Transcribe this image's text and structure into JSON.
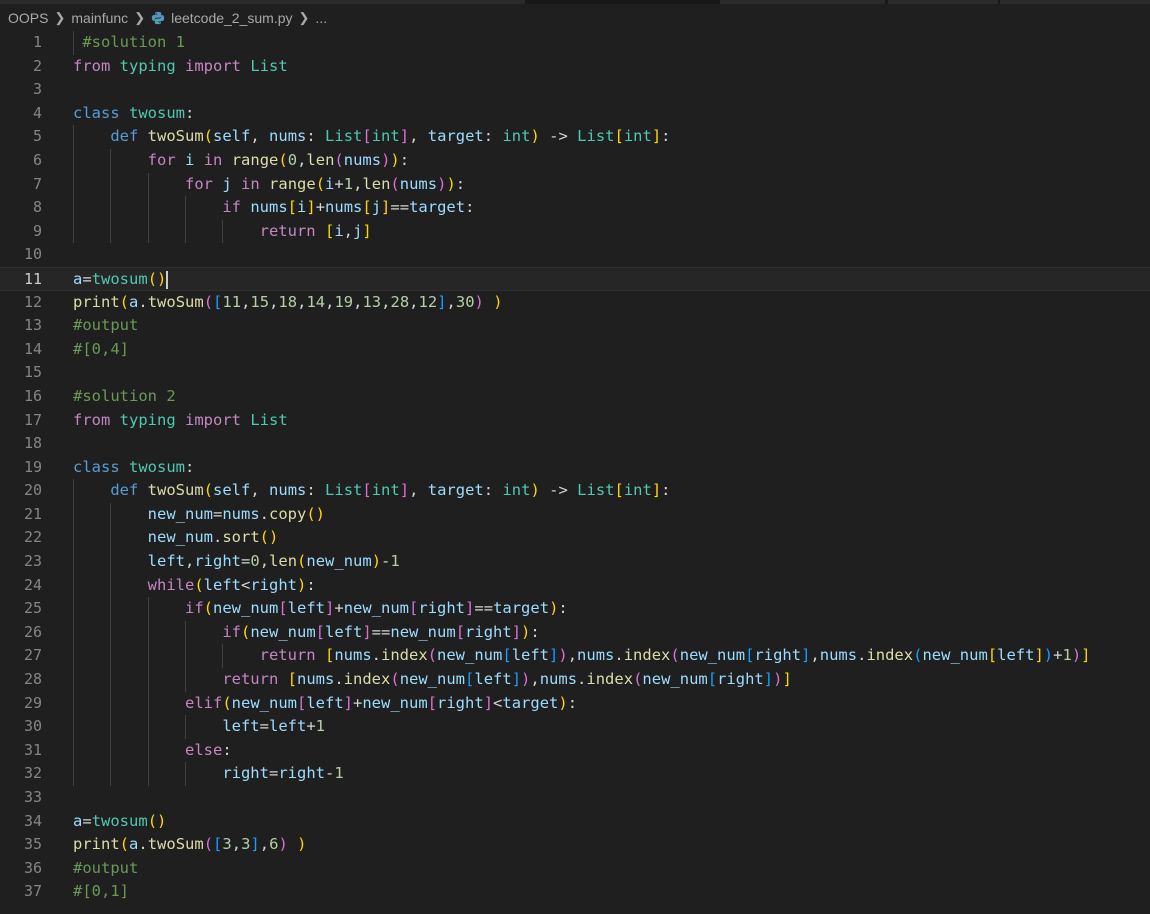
{
  "breadcrumb": {
    "items": [
      "OOPS",
      "mainfunc",
      "leetcode_2_sum.py",
      "..."
    ]
  },
  "editor": {
    "active_line": 11,
    "lines": [
      {
        "n": "1",
        "code": " #solution 1"
      },
      {
        "n": "2",
        "code": "from typing import List"
      },
      {
        "n": "3",
        "code": ""
      },
      {
        "n": "4",
        "code": "class twosum:"
      },
      {
        "n": "5",
        "code": "    def twoSum(self, nums: List[int], target: int) -> List[int]:"
      },
      {
        "n": "6",
        "code": "        for i in range(0,len(nums)):"
      },
      {
        "n": "7",
        "code": "            for j in range(i+1,len(nums)):"
      },
      {
        "n": "8",
        "code": "                if nums[i]+nums[j]==target:"
      },
      {
        "n": "9",
        "code": "                    return [i,j]"
      },
      {
        "n": "10",
        "code": ""
      },
      {
        "n": "11",
        "code": "a=twosum()"
      },
      {
        "n": "12",
        "code": "print(a.twoSum([11,15,18,14,19,13,28,12],30) )"
      },
      {
        "n": "13",
        "code": "#output"
      },
      {
        "n": "14",
        "code": "#[0,4]"
      },
      {
        "n": "15",
        "code": ""
      },
      {
        "n": "16",
        "code": "#solution 2"
      },
      {
        "n": "17",
        "code": "from typing import List"
      },
      {
        "n": "18",
        "code": ""
      },
      {
        "n": "19",
        "code": "class twosum:"
      },
      {
        "n": "20",
        "code": "    def twoSum(self, nums: List[int], target: int) -> List[int]:"
      },
      {
        "n": "21",
        "code": "        new_num=nums.copy()"
      },
      {
        "n": "22",
        "code": "        new_num.sort()"
      },
      {
        "n": "23",
        "code": "        left,right=0,len(new_num)-1"
      },
      {
        "n": "24",
        "code": "        while(left<right):"
      },
      {
        "n": "25",
        "code": "            if(new_num[left]+new_num[right]==target):"
      },
      {
        "n": "26",
        "code": "                if(new_num[left]==new_num[right]):"
      },
      {
        "n": "27",
        "code": "                    return [nums.index(new_num[left]),nums.index(new_num[right],nums.index(new_num[left])+1)]"
      },
      {
        "n": "28",
        "code": "                return [nums.index(new_num[left]),nums.index(new_num[right])]"
      },
      {
        "n": "29",
        "code": "            elif(new_num[left]+new_num[right]<target):"
      },
      {
        "n": "30",
        "code": "                left=left+1"
      },
      {
        "n": "31",
        "code": "            else:"
      },
      {
        "n": "32",
        "code": "                right=right-1"
      },
      {
        "n": "33",
        "code": ""
      },
      {
        "n": "34",
        "code": "a=twosum()"
      },
      {
        "n": "35",
        "code": "print(a.twoSum([3,3],6) )"
      },
      {
        "n": "36",
        "code": "#output"
      },
      {
        "n": "37",
        "code": "#[0,1]"
      }
    ]
  },
  "colors": {
    "background": "#1f1f1f",
    "keyword": "#c586c0",
    "storage": "#569cd6",
    "function": "#dcdcaa",
    "type": "#4ec9b0",
    "variable": "#9cdcfe",
    "number": "#b5cea8",
    "comment": "#6a9955",
    "bracket1": "#ffd700",
    "bracket2": "#da70d6",
    "bracket3": "#179fff"
  },
  "icons": {
    "file_type": "python-file-icon",
    "separator": "chevron-right-icon"
  }
}
